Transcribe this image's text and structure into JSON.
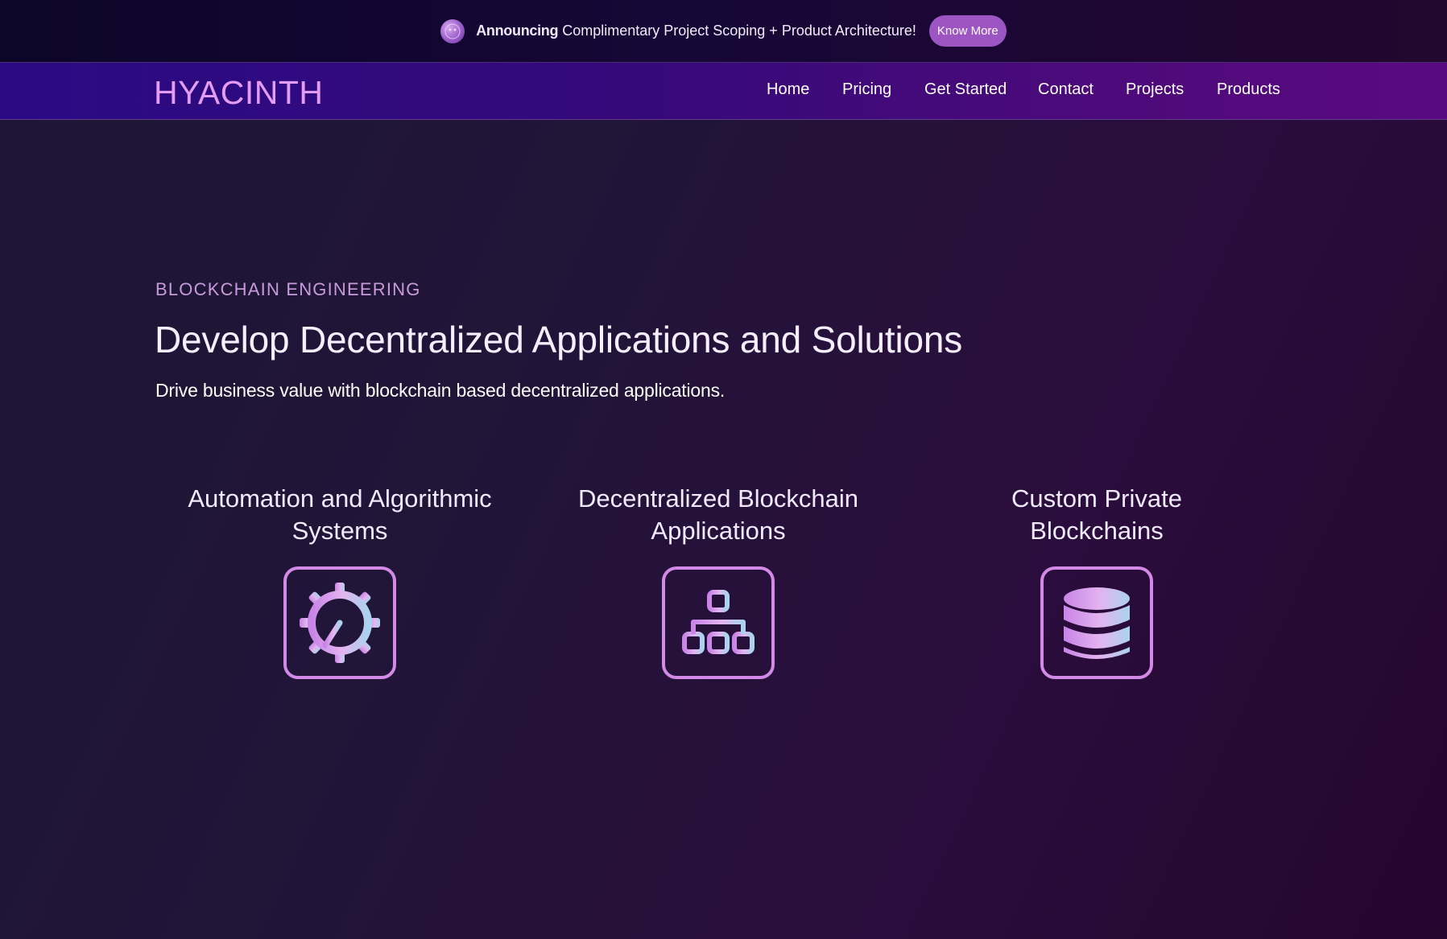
{
  "announcement": {
    "bold": "Announcing",
    "text": " Complimentary Project Scoping + Product Architecture!",
    "button": "Know More",
    "avatar_icon": "avatar-icon"
  },
  "nav": {
    "logo": "HYACINTH",
    "links": [
      "Home",
      "Pricing",
      "Get Started",
      "Contact",
      "Projects",
      "Products"
    ]
  },
  "hero": {
    "eyebrow": "BLOCKCHAIN ENGINEERING",
    "headline": "Develop Decentralized Applications and Solutions",
    "subline": "Drive business value with blockchain based decentralized applications."
  },
  "features": [
    {
      "title_line1": "Automation and Algorithmic",
      "title_line2": "Systems",
      "icon": "gear-icon"
    },
    {
      "title_line1": "Decentralized Blockchain",
      "title_line2": "Applications",
      "icon": "network-icon"
    },
    {
      "title_line1": "Custom Private",
      "title_line2": "Blockchains",
      "icon": "database-icon"
    }
  ],
  "colors": {
    "accent": "#9d55c4",
    "logo": "#e59cf5",
    "eyebrow": "#c89ad9",
    "icon_border": "#d28ae6"
  }
}
